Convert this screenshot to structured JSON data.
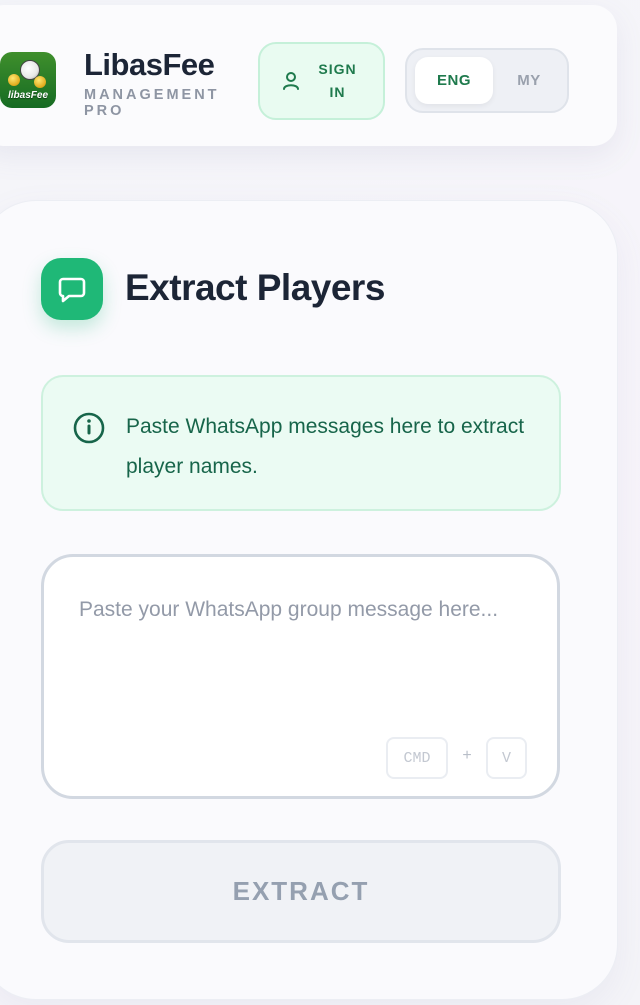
{
  "header": {
    "logo_text": "libasFee",
    "brand_name": "LibasFee",
    "brand_subtitle": "MANAGEMENT PRO",
    "sign_in_label": "SIGN IN",
    "languages": [
      {
        "label": "ENG",
        "active": true
      },
      {
        "label": "MY",
        "active": false
      }
    ]
  },
  "main": {
    "title": "Extract Players",
    "info_text": "Paste WhatsApp messages here to extract player names.",
    "message_input": {
      "value": "",
      "placeholder": "Paste your WhatsApp group message here..."
    },
    "shortcut": {
      "key1": "CMD",
      "separator": "+",
      "key2": "V"
    },
    "extract_label": "EXTRACT"
  },
  "colors": {
    "accent": "#1fb877",
    "accent_text": "#1f7a4d",
    "info_bg": "#ebfbf3",
    "title_text": "#1c2536",
    "muted_text": "#8e95a3"
  },
  "icons": {
    "title_icon": "chat-bubble-icon",
    "info_icon": "info-circle-icon",
    "sign_in_icon": "user-icon"
  }
}
